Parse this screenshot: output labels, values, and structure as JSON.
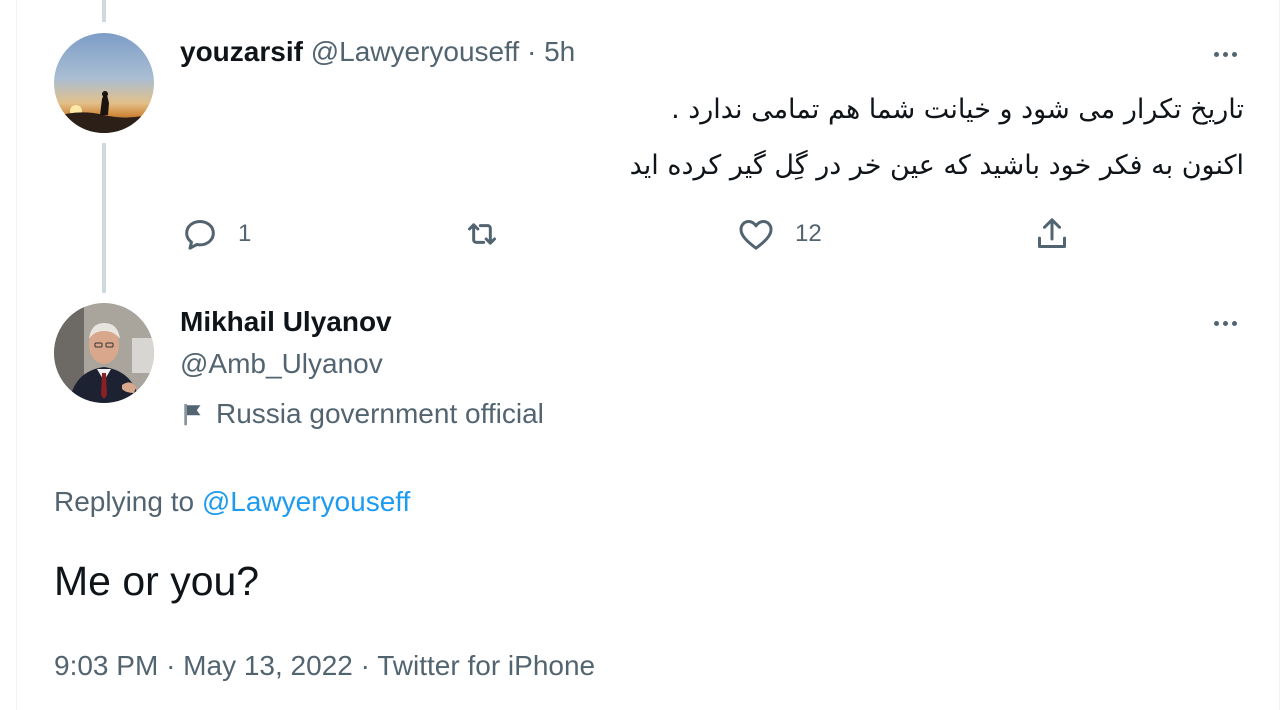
{
  "reply_tweet": {
    "display_name": "youzarsif",
    "handle": "@Lawyeryouseff",
    "separator": "·",
    "time": "5h",
    "text_lines": [
      "تاریخ تکرار می شود و خیانت شما هم تمامی ندارد .",
      "اکنون به فکر خود باشید که عین خر در گِل گیر کرده اید"
    ],
    "actions": {
      "reply_count": "1",
      "retweet_count": "",
      "like_count": "12"
    },
    "icons": [
      "reply-icon",
      "retweet-icon",
      "like-icon",
      "share-icon",
      "more-icon"
    ]
  },
  "main_tweet": {
    "display_name": "Mikhail Ulyanov",
    "handle": "@Amb_Ulyanov",
    "label": "Russia government official",
    "replying_prefix": "Replying to",
    "replying_handle": "@Lawyeryouseff",
    "text": "Me or you?",
    "time": "9:03 PM",
    "date": "May 13, 2022",
    "source": "Twitter for iPhone",
    "separator": "·",
    "icons": [
      "flag-icon",
      "more-icon"
    ]
  },
  "colors": {
    "text_primary": "#0f1419",
    "text_secondary": "#536471",
    "accent": "#1d9bf0",
    "thread_line": "#cfd9de"
  }
}
